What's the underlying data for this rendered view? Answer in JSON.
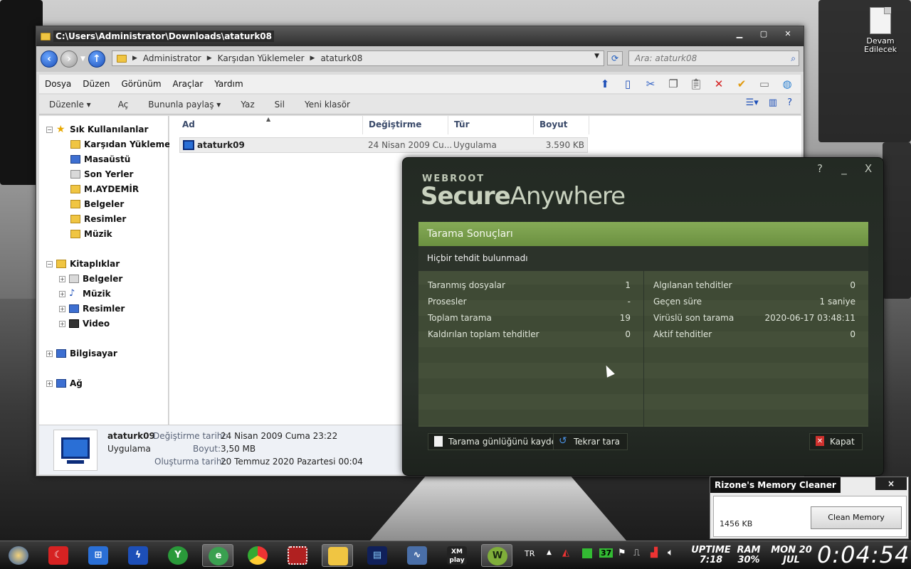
{
  "desktop": {
    "icon_label": "Devam Edilecek"
  },
  "explorer": {
    "title": "C:\\Users\\Administrator\\Downloads\\ataturk08",
    "breadcrumb": [
      "Administrator",
      "Karşıdan Yüklemeler",
      "ataturk08"
    ],
    "search_placeholder": "Ara: ataturk08",
    "menu": [
      "Dosya",
      "Düzen",
      "Görünüm",
      "Araçlar",
      "Yardım"
    ],
    "commands": [
      "Düzenle ▾",
      "Aç",
      "Bununla paylaş ▾",
      "Yaz",
      "Sil",
      "Yeni klasör"
    ],
    "nav": {
      "favorites": "Sık Kullanılanlar",
      "fav_items": [
        "Karşıdan Yüklemeler",
        "Masaüstü",
        "Son Yerler",
        "M.AYDEMİR",
        "Belgeler",
        "Resimler",
        "Müzik"
      ],
      "libraries": "Kitaplıklar",
      "lib_items": [
        "Belgeler",
        "Müzik",
        "Resimler",
        "Video"
      ],
      "computer": "Bilgisayar",
      "network": "Ağ"
    },
    "columns": [
      "Ad",
      "Değiştirme tarihi",
      "Tür",
      "Boyut"
    ],
    "files": [
      {
        "name": "ataturk09",
        "modified": "24 Nisan 2009 Cu...",
        "type": "Uygulama",
        "size": "3.590 KB"
      }
    ],
    "details": {
      "name": "ataturk09",
      "type": "Uygulama",
      "modified_label": "Değiştirme tarihi:",
      "modified_value": "24 Nisan 2009 Cuma 23:22",
      "size_label": "Boyut:",
      "size_value": "3,50 MB",
      "created_label": "Oluşturma tarihi:",
      "created_value": "20 Temmuz 2020 Pazartesi 00:04"
    }
  },
  "webroot": {
    "controls": [
      "?",
      "_",
      "X"
    ],
    "brand_small": "WEBROOT",
    "brand_secure": "Secure",
    "brand_anywhere": "Anywhere",
    "panel_title": "Tarama Sonuçları",
    "status": "Hiçbir tehdit bulunmadı",
    "left_rows": [
      {
        "label": "Taranmış dosyalar",
        "value": "1"
      },
      {
        "label": "Prosesler",
        "value": "-"
      },
      {
        "label": "Toplam tarama",
        "value": "19"
      },
      {
        "label": "Kaldırılan toplam tehditler",
        "value": "0"
      }
    ],
    "right_rows": [
      {
        "label": "Algılanan tehditler",
        "value": "0"
      },
      {
        "label": "Geçen süre",
        "value": "1 saniye"
      },
      {
        "label": "Virüslü son tarama",
        "value": "2020-06-17 03:48:11"
      },
      {
        "label": "Aktif tehditler",
        "value": "0"
      }
    ],
    "buttons": {
      "save_log": "Tarama günlüğünü kaydet",
      "rescan": "Tekrar tara",
      "close": "Kapat"
    }
  },
  "memory_cleaner": {
    "title": "Rizone's Memory Cleaner",
    "close": "×",
    "value": "1456 KB",
    "button": "Clean Memory"
  },
  "taskbar": {
    "lang": "TR",
    "tray_badge": "37",
    "uptime_label": "UPTIME",
    "uptime_value": "7:18",
    "ram_label": "RAM",
    "ram_value": "30%",
    "date_day": "MON 20",
    "date_month": "JUL",
    "clock": "0:04:54",
    "xm_label": "XM play"
  }
}
